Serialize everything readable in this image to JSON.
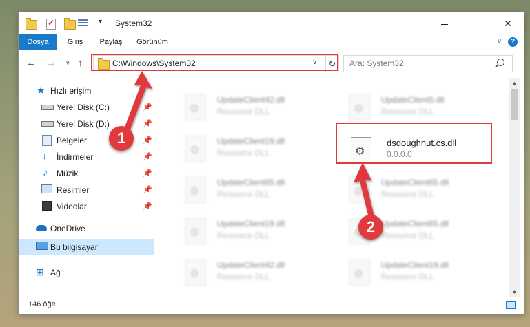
{
  "window": {
    "title": "System32",
    "quick_access_dropdown": "▾",
    "minimize_glyph": "",
    "maximize_glyph": "",
    "close_glyph": "✕"
  },
  "ribbon": {
    "tabs": [
      {
        "label": "Dosya"
      },
      {
        "label": "Giriş"
      },
      {
        "label": "Paylaş"
      },
      {
        "label": "Görünüm"
      }
    ],
    "expand_glyph": "∨",
    "help_glyph": "?"
  },
  "nav": {
    "back_glyph": "←",
    "forward_glyph": "→",
    "recent_glyph": "∨",
    "up_glyph": "↑",
    "address": "C:\\Windows\\System32",
    "address_dropdown_glyph": "∨",
    "refresh_glyph": "↻",
    "search_placeholder": "Ara: System32"
  },
  "sidebar": {
    "items": [
      {
        "label": "Hızlı erişim",
        "icon": "star-icon",
        "pinned": false
      },
      {
        "label": "Yerel Disk (C:)",
        "icon": "disk-icon",
        "pinned": true
      },
      {
        "label": "Yerel Disk (D:)",
        "icon": "disk-icon",
        "pinned": true
      },
      {
        "label": "Belgeler",
        "icon": "documents-icon",
        "pinned": true
      },
      {
        "label": "İndirmeler",
        "icon": "download-icon",
        "pinned": true
      },
      {
        "label": "Müzik",
        "icon": "music-icon",
        "pinned": true
      },
      {
        "label": "Resimler",
        "icon": "pictures-icon",
        "pinned": true
      },
      {
        "label": "Videolar",
        "icon": "video-icon",
        "pinned": true
      },
      {
        "label": "OneDrive",
        "icon": "cloud-icon",
        "pinned": false
      },
      {
        "label": "Bu bilgisayar",
        "icon": "computer-icon",
        "pinned": false,
        "selected": true
      },
      {
        "label": "Ağ",
        "icon": "network-icon",
        "pinned": false
      }
    ],
    "pin_glyph": "📌"
  },
  "files": [
    {
      "name": "UpdateClient42.dll",
      "desc": "Resource DLL",
      "blurred": true
    },
    {
      "name": "UpdateClient5.dll",
      "desc": "Resource DLL",
      "blurred": true
    },
    {
      "name": "UpdateClient19.dll",
      "desc": "Resource DLL",
      "blurred": true
    },
    {
      "name": "dsdoughnut.cs.dll",
      "desc": "0.0.0.0",
      "blurred": false
    },
    {
      "name": "UpdateClient65.dll",
      "desc": "Resource DLL",
      "blurred": true
    },
    {
      "name": "UpdateClient65.dll",
      "desc": "Resource DLL",
      "blurred": true
    },
    {
      "name": "UpdateClient19.dll",
      "desc": "Resource DLL",
      "blurred": true
    },
    {
      "name": "UpdateClient65.dll",
      "desc": "Resource DLL",
      "blurred": true
    },
    {
      "name": "UpdateClient42.dll",
      "desc": "Resource DLL",
      "blurred": true
    },
    {
      "name": "UpdateClient19.dll",
      "desc": "Resource DLL",
      "blurred": true
    }
  ],
  "status": {
    "item_count": "146 öğe"
  },
  "callouts": {
    "step1": "1",
    "step2": "2",
    "color": "#e0393e"
  },
  "colors": {
    "accent": "#1979ca",
    "selection": "#cce8ff",
    "highlight": "#e0393e"
  }
}
